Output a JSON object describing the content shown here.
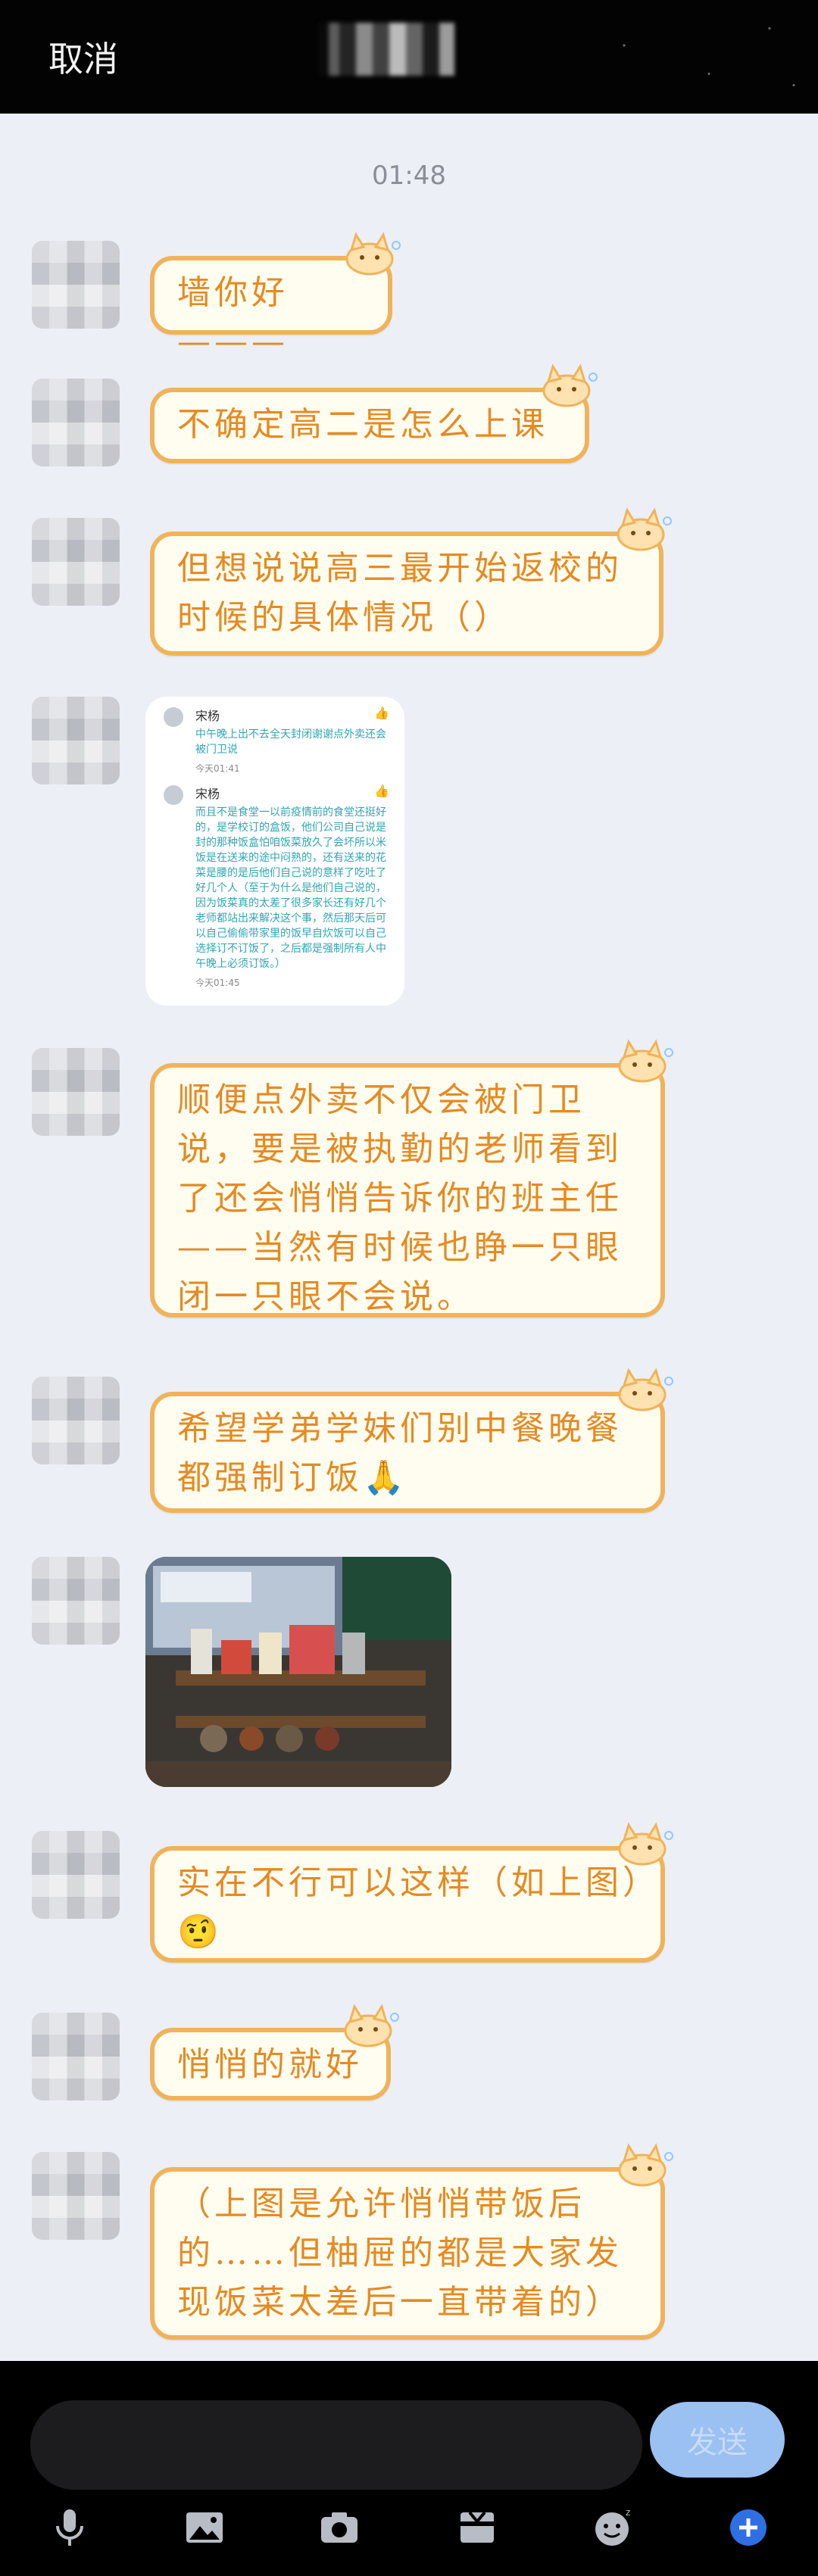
{
  "header": {
    "cancel_label": "取消"
  },
  "timestamp": "01:48",
  "messages": [
    {
      "text": "墙你好———"
    },
    {
      "text": "不确定高二是怎么上课"
    },
    {
      "text": "但想说说高三最开始返校的时候的具体情况（）"
    },
    {
      "type": "image",
      "note": {
        "items": [
          {
            "name": "宋杨",
            "text": "中午晚上出不去全天封闭谢谢点外卖还会被门卫说",
            "time": "今天01:41"
          },
          {
            "name": "宋杨",
            "text": "而且不是食堂一以前疫情前的食堂还挺好的，是学校订的盒饭，他们公司自己说是封的那种饭盒怕咱饭菜放久了会坏所以米饭是在送来的途中闷熟的，还有送来的花菜是腰的是后他们自己说的意样了吃吐了好几个人（至于为什么是他们自己说的，因为饭菜真的太差了很多家长还有好几个老师都站出来解决这个事，然后那天后可以自己偷偷带家里的饭早自炊饭可以自己选择订不订饭了，之后都是强制所有人中午晚上必须订饭。）",
            "time": "今天01:45"
          }
        ]
      }
    },
    {
      "text": "顺便点外卖不仅会被门卫说，要是被执勤的老师看到了还会悄悄告诉你的班主任——当然有时候也睁一只眼闭一只眼不会说。"
    },
    {
      "text": "希望学弟学妹们别中餐晚餐都强制订饭🙏"
    },
    {
      "type": "photo"
    },
    {
      "text": "实在不行可以这样（如上图）🤨"
    },
    {
      "text": "悄悄的就好"
    },
    {
      "text": "（上图是允许悄悄带饭后的……但柚屉的都是大家发现饭菜太差后一直带着的）"
    }
  ],
  "composer": {
    "input_value": "",
    "send_label": "发送"
  },
  "toolbar": [
    "microphone-icon",
    "image-icon",
    "camera-icon",
    "gift-box-icon",
    "emoji-icon",
    "plus-icon"
  ],
  "colors": {
    "bubble_border": "#f0b35a",
    "bubble_text": "#e58a22",
    "accent_blue": "#2f6fe4",
    "send_button": "#9bc0f2"
  }
}
